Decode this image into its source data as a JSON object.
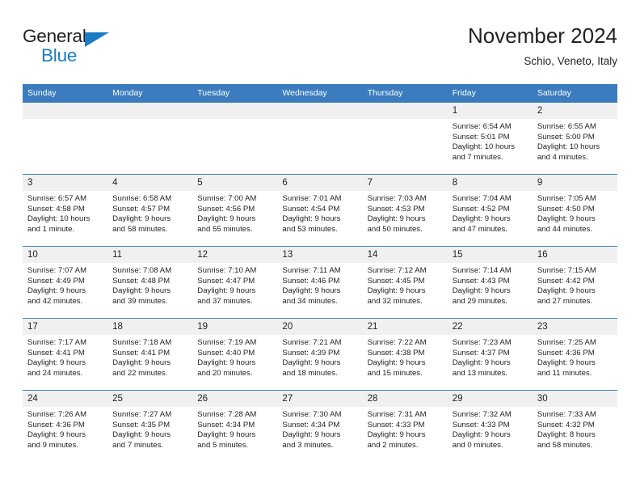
{
  "brand": {
    "name_part1": "General",
    "name_part2": "Blue",
    "accent_color": "#1a7dc4",
    "triangle_icon": "triangle-icon"
  },
  "header": {
    "title": "November 2024",
    "location": "Schio, Veneto, Italy"
  },
  "calendar": {
    "header_bg": "#3a7cbe",
    "daynum_bg": "#f0f0f0",
    "weekdays": [
      "Sunday",
      "Monday",
      "Tuesday",
      "Wednesday",
      "Thursday",
      "Friday",
      "Saturday"
    ],
    "weeks": [
      [
        {
          "day": "",
          "sunrise": "",
          "sunset": "",
          "daylight1": "",
          "daylight2": ""
        },
        {
          "day": "",
          "sunrise": "",
          "sunset": "",
          "daylight1": "",
          "daylight2": ""
        },
        {
          "day": "",
          "sunrise": "",
          "sunset": "",
          "daylight1": "",
          "daylight2": ""
        },
        {
          "day": "",
          "sunrise": "",
          "sunset": "",
          "daylight1": "",
          "daylight2": ""
        },
        {
          "day": "",
          "sunrise": "",
          "sunset": "",
          "daylight1": "",
          "daylight2": ""
        },
        {
          "day": "1",
          "sunrise": "Sunrise: 6:54 AM",
          "sunset": "Sunset: 5:01 PM",
          "daylight1": "Daylight: 10 hours",
          "daylight2": "and 7 minutes."
        },
        {
          "day": "2",
          "sunrise": "Sunrise: 6:55 AM",
          "sunset": "Sunset: 5:00 PM",
          "daylight1": "Daylight: 10 hours",
          "daylight2": "and 4 minutes."
        }
      ],
      [
        {
          "day": "3",
          "sunrise": "Sunrise: 6:57 AM",
          "sunset": "Sunset: 4:58 PM",
          "daylight1": "Daylight: 10 hours",
          "daylight2": "and 1 minute."
        },
        {
          "day": "4",
          "sunrise": "Sunrise: 6:58 AM",
          "sunset": "Sunset: 4:57 PM",
          "daylight1": "Daylight: 9 hours",
          "daylight2": "and 58 minutes."
        },
        {
          "day": "5",
          "sunrise": "Sunrise: 7:00 AM",
          "sunset": "Sunset: 4:56 PM",
          "daylight1": "Daylight: 9 hours",
          "daylight2": "and 55 minutes."
        },
        {
          "day": "6",
          "sunrise": "Sunrise: 7:01 AM",
          "sunset": "Sunset: 4:54 PM",
          "daylight1": "Daylight: 9 hours",
          "daylight2": "and 53 minutes."
        },
        {
          "day": "7",
          "sunrise": "Sunrise: 7:03 AM",
          "sunset": "Sunset: 4:53 PM",
          "daylight1": "Daylight: 9 hours",
          "daylight2": "and 50 minutes."
        },
        {
          "day": "8",
          "sunrise": "Sunrise: 7:04 AM",
          "sunset": "Sunset: 4:52 PM",
          "daylight1": "Daylight: 9 hours",
          "daylight2": "and 47 minutes."
        },
        {
          "day": "9",
          "sunrise": "Sunrise: 7:05 AM",
          "sunset": "Sunset: 4:50 PM",
          "daylight1": "Daylight: 9 hours",
          "daylight2": "and 44 minutes."
        }
      ],
      [
        {
          "day": "10",
          "sunrise": "Sunrise: 7:07 AM",
          "sunset": "Sunset: 4:49 PM",
          "daylight1": "Daylight: 9 hours",
          "daylight2": "and 42 minutes."
        },
        {
          "day": "11",
          "sunrise": "Sunrise: 7:08 AM",
          "sunset": "Sunset: 4:48 PM",
          "daylight1": "Daylight: 9 hours",
          "daylight2": "and 39 minutes."
        },
        {
          "day": "12",
          "sunrise": "Sunrise: 7:10 AM",
          "sunset": "Sunset: 4:47 PM",
          "daylight1": "Daylight: 9 hours",
          "daylight2": "and 37 minutes."
        },
        {
          "day": "13",
          "sunrise": "Sunrise: 7:11 AM",
          "sunset": "Sunset: 4:46 PM",
          "daylight1": "Daylight: 9 hours",
          "daylight2": "and 34 minutes."
        },
        {
          "day": "14",
          "sunrise": "Sunrise: 7:12 AM",
          "sunset": "Sunset: 4:45 PM",
          "daylight1": "Daylight: 9 hours",
          "daylight2": "and 32 minutes."
        },
        {
          "day": "15",
          "sunrise": "Sunrise: 7:14 AM",
          "sunset": "Sunset: 4:43 PM",
          "daylight1": "Daylight: 9 hours",
          "daylight2": "and 29 minutes."
        },
        {
          "day": "16",
          "sunrise": "Sunrise: 7:15 AM",
          "sunset": "Sunset: 4:42 PM",
          "daylight1": "Daylight: 9 hours",
          "daylight2": "and 27 minutes."
        }
      ],
      [
        {
          "day": "17",
          "sunrise": "Sunrise: 7:17 AM",
          "sunset": "Sunset: 4:41 PM",
          "daylight1": "Daylight: 9 hours",
          "daylight2": "and 24 minutes."
        },
        {
          "day": "18",
          "sunrise": "Sunrise: 7:18 AM",
          "sunset": "Sunset: 4:41 PM",
          "daylight1": "Daylight: 9 hours",
          "daylight2": "and 22 minutes."
        },
        {
          "day": "19",
          "sunrise": "Sunrise: 7:19 AM",
          "sunset": "Sunset: 4:40 PM",
          "daylight1": "Daylight: 9 hours",
          "daylight2": "and 20 minutes."
        },
        {
          "day": "20",
          "sunrise": "Sunrise: 7:21 AM",
          "sunset": "Sunset: 4:39 PM",
          "daylight1": "Daylight: 9 hours",
          "daylight2": "and 18 minutes."
        },
        {
          "day": "21",
          "sunrise": "Sunrise: 7:22 AM",
          "sunset": "Sunset: 4:38 PM",
          "daylight1": "Daylight: 9 hours",
          "daylight2": "and 15 minutes."
        },
        {
          "day": "22",
          "sunrise": "Sunrise: 7:23 AM",
          "sunset": "Sunset: 4:37 PM",
          "daylight1": "Daylight: 9 hours",
          "daylight2": "and 13 minutes."
        },
        {
          "day": "23",
          "sunrise": "Sunrise: 7:25 AM",
          "sunset": "Sunset: 4:36 PM",
          "daylight1": "Daylight: 9 hours",
          "daylight2": "and 11 minutes."
        }
      ],
      [
        {
          "day": "24",
          "sunrise": "Sunrise: 7:26 AM",
          "sunset": "Sunset: 4:36 PM",
          "daylight1": "Daylight: 9 hours",
          "daylight2": "and 9 minutes."
        },
        {
          "day": "25",
          "sunrise": "Sunrise: 7:27 AM",
          "sunset": "Sunset: 4:35 PM",
          "daylight1": "Daylight: 9 hours",
          "daylight2": "and 7 minutes."
        },
        {
          "day": "26",
          "sunrise": "Sunrise: 7:28 AM",
          "sunset": "Sunset: 4:34 PM",
          "daylight1": "Daylight: 9 hours",
          "daylight2": "and 5 minutes."
        },
        {
          "day": "27",
          "sunrise": "Sunrise: 7:30 AM",
          "sunset": "Sunset: 4:34 PM",
          "daylight1": "Daylight: 9 hours",
          "daylight2": "and 3 minutes."
        },
        {
          "day": "28",
          "sunrise": "Sunrise: 7:31 AM",
          "sunset": "Sunset: 4:33 PM",
          "daylight1": "Daylight: 9 hours",
          "daylight2": "and 2 minutes."
        },
        {
          "day": "29",
          "sunrise": "Sunrise: 7:32 AM",
          "sunset": "Sunset: 4:33 PM",
          "daylight1": "Daylight: 9 hours",
          "daylight2": "and 0 minutes."
        },
        {
          "day": "30",
          "sunrise": "Sunrise: 7:33 AM",
          "sunset": "Sunset: 4:32 PM",
          "daylight1": "Daylight: 8 hours",
          "daylight2": "and 58 minutes."
        }
      ]
    ]
  }
}
